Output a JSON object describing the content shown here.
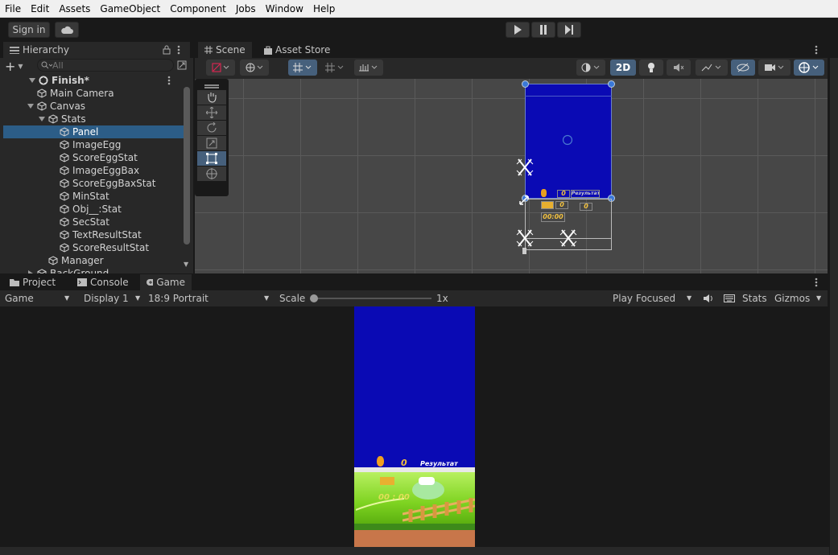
{
  "menu": [
    "File",
    "Edit",
    "Assets",
    "GameObject",
    "Component",
    "Jobs",
    "Window",
    "Help"
  ],
  "toolbar": {
    "sign_in": "Sign in"
  },
  "hierarchy": {
    "tab": "Hierarchy",
    "search_placeholder": "All",
    "scene_name": "Finish*",
    "items": [
      {
        "label": "Main Camera",
        "depth": 1,
        "expanded": false,
        "children": false
      },
      {
        "label": "Canvas",
        "depth": 1,
        "expanded": true,
        "children": true
      },
      {
        "label": "Stats",
        "depth": 2,
        "expanded": true,
        "children": true
      },
      {
        "label": "Panel",
        "depth": 3,
        "expanded": false,
        "children": false,
        "selected": true
      },
      {
        "label": "ImageEgg",
        "depth": 3,
        "expanded": false,
        "children": false
      },
      {
        "label": "ScoreEggStat",
        "depth": 3,
        "expanded": false,
        "children": false
      },
      {
        "label": "ImageEggBax",
        "depth": 3,
        "expanded": false,
        "children": false
      },
      {
        "label": "ScoreEggBaxStat",
        "depth": 3,
        "expanded": false,
        "children": false
      },
      {
        "label": "MinStat",
        "depth": 3,
        "expanded": false,
        "children": false
      },
      {
        "label": "Obj__:Stat",
        "depth": 3,
        "expanded": false,
        "children": false
      },
      {
        "label": "SecStat",
        "depth": 3,
        "expanded": false,
        "children": false
      },
      {
        "label": "TextResultStat",
        "depth": 3,
        "expanded": false,
        "children": false
      },
      {
        "label": "ScoreResultStat",
        "depth": 3,
        "expanded": false,
        "children": false
      },
      {
        "label": "Manager",
        "depth": 2,
        "expanded": false,
        "children": false
      },
      {
        "label": "BackGround",
        "depth": 1,
        "expanded": false,
        "children": true
      }
    ]
  },
  "scene": {
    "tabs": [
      "Scene",
      "Asset Store"
    ],
    "mode_2d": "2D",
    "canvas_texts": {
      "score": "0",
      "result": "Результат",
      "score2": "0",
      "score3": "0",
      "time": "00:00"
    }
  },
  "bottom": {
    "tabs": [
      "Project",
      "Console",
      "Game"
    ],
    "game_dropdown": "Game",
    "display": "Display 1",
    "aspect": "18:9 Portrait",
    "scale_label": "Scale",
    "scale_value": "1x",
    "play_focused": "Play Focused",
    "stats": "Stats",
    "gizmos": "Gizmos"
  },
  "game_view": {
    "score": "0",
    "result": "Результат",
    "time": "00 : 00"
  },
  "colors": {
    "panel_blue": "#0a0ab4",
    "selection": "#2c5d87",
    "grass": "#7ed321"
  }
}
